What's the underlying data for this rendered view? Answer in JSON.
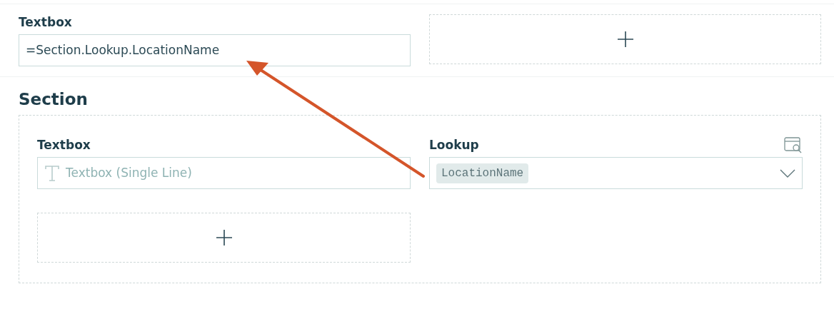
{
  "top": {
    "fields": [
      {
        "kind": "textbox",
        "label": "Textbox",
        "value": "=Section.Lookup.LocationName"
      },
      {
        "kind": "add"
      }
    ]
  },
  "section": {
    "title": "Section",
    "fields": [
      {
        "kind": "textbox",
        "label": "Textbox",
        "placeholder": "Textbox (Single Line)"
      },
      {
        "kind": "lookup",
        "label": "Lookup",
        "tag": "LocationName"
      },
      {
        "kind": "add"
      }
    ]
  }
}
